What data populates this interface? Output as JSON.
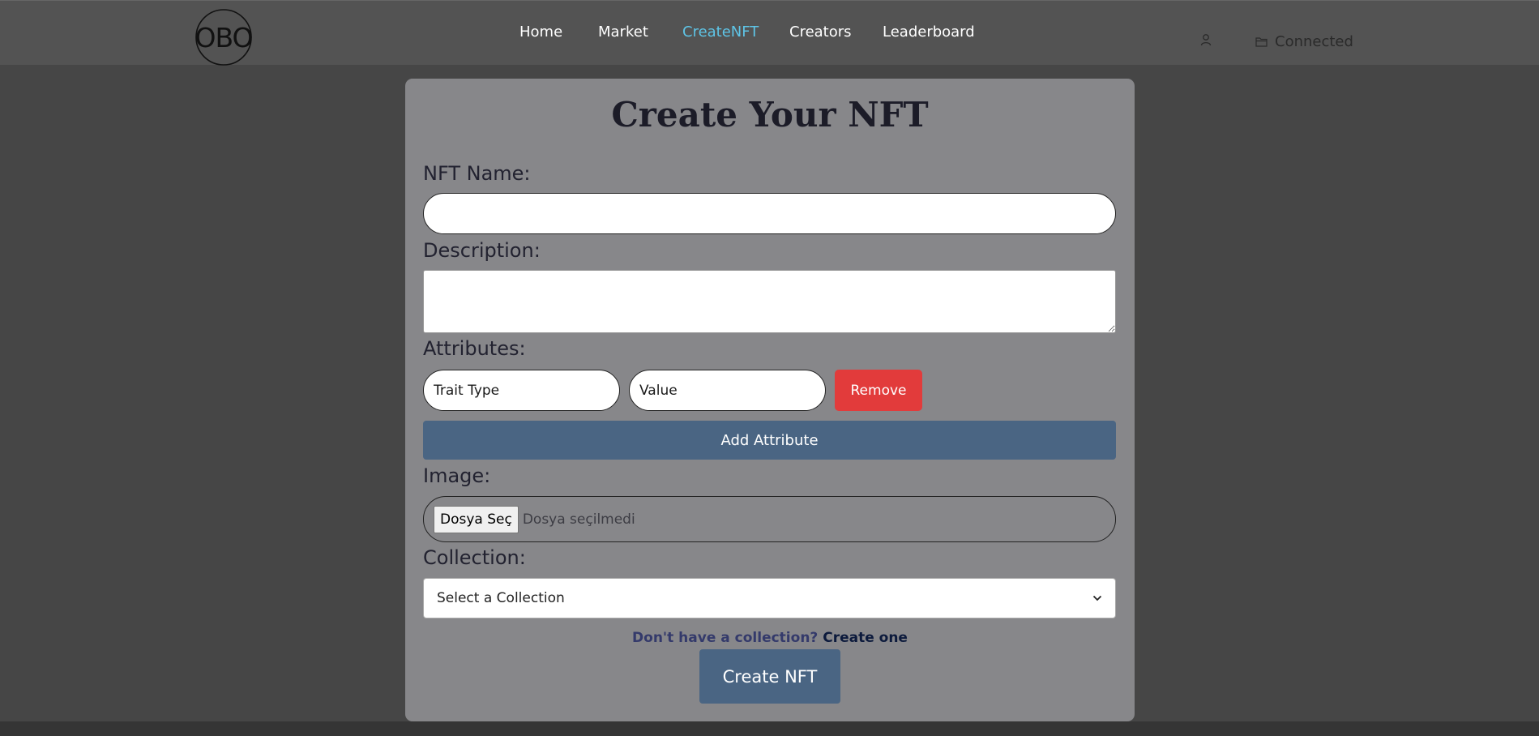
{
  "header": {
    "logo_text": "OBO",
    "nav": [
      {
        "label": "Home",
        "active": false
      },
      {
        "label": "Market",
        "active": false
      },
      {
        "label": "CreateNFT",
        "active": true
      },
      {
        "label": "Creators",
        "active": false
      },
      {
        "label": "Leaderboard",
        "active": false
      }
    ],
    "user_icon": "user-icon",
    "wallet_icon": "folder-icon",
    "wallet_status": "Connected"
  },
  "form": {
    "title": "Create Your NFT",
    "name_label": "NFT Name:",
    "name_value": "",
    "description_label": "Description:",
    "description_value": "",
    "attributes_label": "Attributes:",
    "attributes": [
      {
        "trait_placeholder": "Trait Type",
        "value_placeholder": "Value",
        "remove_label": "Remove"
      }
    ],
    "add_attribute_label": "Add Attribute",
    "image_label": "Image:",
    "file_button_label": "Dosya Seç",
    "file_status": "Dosya seçilmedi",
    "collection_label": "Collection:",
    "collection_selected": "Select a Collection",
    "hint_text": "Don't have a collection?",
    "hint_link": "Create one",
    "submit_label": "Create NFT"
  },
  "colors": {
    "background": "#464646",
    "header": "#535353",
    "card": "#87878a",
    "active_nav": "#5ec4e6",
    "primary_button": "#4a6583",
    "danger_button": "#e23b3b"
  }
}
